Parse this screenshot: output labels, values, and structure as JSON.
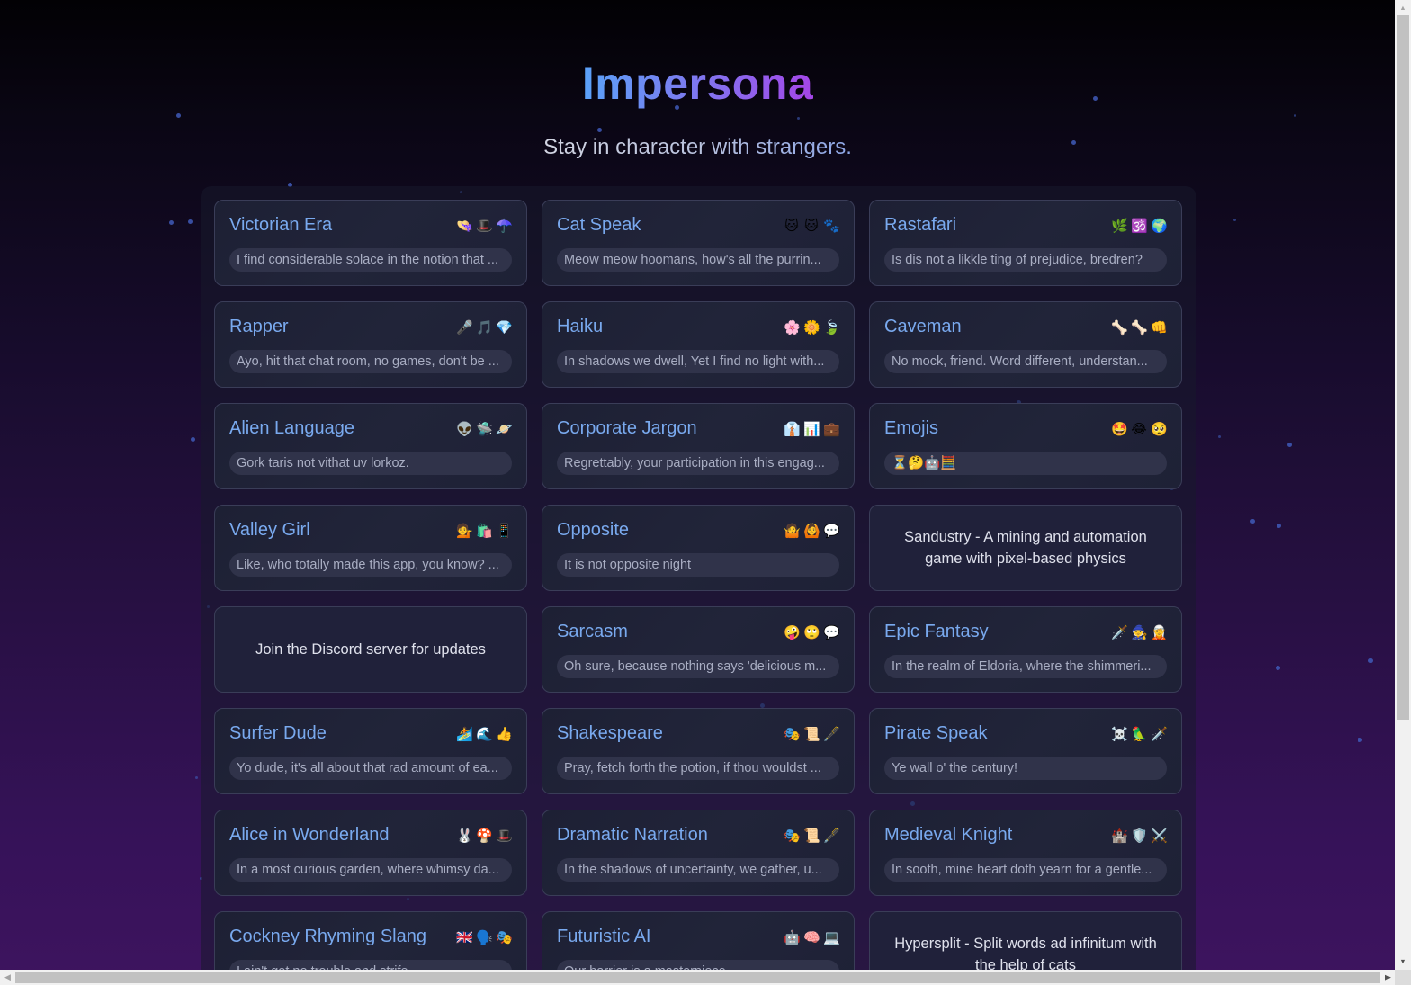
{
  "app": {
    "title": "Impersona",
    "tagline": "Stay in character with strangers."
  },
  "personas": [
    {
      "type": "persona",
      "name": "Victorian Era",
      "icons": [
        "👒",
        "🎩",
        "☂️"
      ],
      "snippet": "I find considerable solace in the notion that ..."
    },
    {
      "type": "persona",
      "name": "Cat Speak",
      "icons": [
        "🐱",
        "🐱",
        "🐾"
      ],
      "snippet": "Meow meow hoomans, how's all the purrin..."
    },
    {
      "type": "persona",
      "name": "Rastafari",
      "icons": [
        "🌿",
        "🕉️",
        "🌍"
      ],
      "snippet": "Is dis not a likkle ting of prejudice, bredren?"
    },
    {
      "type": "persona",
      "name": "Rapper",
      "icons": [
        "🎤",
        "🎵",
        "💎"
      ],
      "snippet": "Ayo, hit that chat room, no games, don't be ..."
    },
    {
      "type": "persona",
      "name": "Haiku",
      "icons": [
        "🌸",
        "🌼",
        "🍃"
      ],
      "snippet": "In shadows we dwell, Yet I find no light with..."
    },
    {
      "type": "persona",
      "name": "Caveman",
      "icons": [
        "🦴",
        "🦴",
        "👊"
      ],
      "snippet": "No mock, friend. Word different, understan..."
    },
    {
      "type": "persona",
      "name": "Alien Language",
      "icons": [
        "👽",
        "🛸",
        "🪐"
      ],
      "snippet": "Gork taris not vithat uv lorkoz."
    },
    {
      "type": "persona",
      "name": "Corporate Jargon",
      "icons": [
        "👔",
        "📊",
        "💼"
      ],
      "snippet": "Regrettably, your participation in this engag..."
    },
    {
      "type": "persona",
      "name": "Emojis",
      "icons": [
        "🤩",
        "😂",
        "🥺"
      ],
      "snippet": "⏳🤔🤖🧮"
    },
    {
      "type": "persona",
      "name": "Valley Girl",
      "icons": [
        "💁",
        "🛍️",
        "📱"
      ],
      "snippet": "Like, who totally made this app, you know? ..."
    },
    {
      "type": "persona",
      "name": "Opposite",
      "icons": [
        "🤷",
        "🙆",
        "💬"
      ],
      "snippet": "It is not opposite night"
    },
    {
      "type": "promo",
      "text": "Sandustry - A mining and automation game with pixel-based physics"
    },
    {
      "type": "promo",
      "text": "Join the Discord server for updates"
    },
    {
      "type": "persona",
      "name": "Sarcasm",
      "icons": [
        "🤪",
        "🙄",
        "💬"
      ],
      "snippet": "Oh sure, because nothing says 'delicious m..."
    },
    {
      "type": "persona",
      "name": "Epic Fantasy",
      "icons": [
        "🗡️",
        "🧙",
        "🧝"
      ],
      "snippet": "In the realm of Eldoria, where the shimmeri..."
    },
    {
      "type": "persona",
      "name": "Surfer Dude",
      "icons": [
        "🏄",
        "🌊",
        "👍"
      ],
      "snippet": "Yo dude, it's all about that rad amount of ea..."
    },
    {
      "type": "persona",
      "name": "Shakespeare",
      "icons": [
        "🎭",
        "📜",
        "🖋️"
      ],
      "snippet": "Pray, fetch forth the potion, if thou wouldst ..."
    },
    {
      "type": "persona",
      "name": "Pirate Speak",
      "icons": [
        "☠️",
        "🦜",
        "🗡️"
      ],
      "snippet": "Ye wall o' the century!"
    },
    {
      "type": "persona",
      "name": "Alice in Wonderland",
      "icons": [
        "🐰",
        "🍄",
        "🎩"
      ],
      "snippet": "In a most curious garden, where whimsy da..."
    },
    {
      "type": "persona",
      "name": "Dramatic Narration",
      "icons": [
        "🎭",
        "📜",
        "🖋️"
      ],
      "snippet": "In the shadows of uncertainty, we gather, u..."
    },
    {
      "type": "persona",
      "name": "Medieval Knight",
      "icons": [
        "🏰",
        "🛡️",
        "⚔️"
      ],
      "snippet": "In sooth, mine heart doth yearn for a gentle..."
    },
    {
      "type": "persona",
      "name": "Cockney Rhyming Slang",
      "icons": [
        "🇬🇧",
        "🗣️",
        "🎭"
      ],
      "snippet": "I ain't got no trouble and strife"
    },
    {
      "type": "persona",
      "name": "Futuristic AI",
      "icons": [
        "🤖",
        "🧠",
        "💻"
      ],
      "snippet": "Our barrier is a masterpiece"
    },
    {
      "type": "promo",
      "text": "Hypersplit - Split words ad infinitum with the help of cats"
    }
  ],
  "scrollbars": {
    "up_arrow": "▲",
    "down_arrow": "▼",
    "left_arrow": "◀",
    "right_arrow": "▶"
  }
}
